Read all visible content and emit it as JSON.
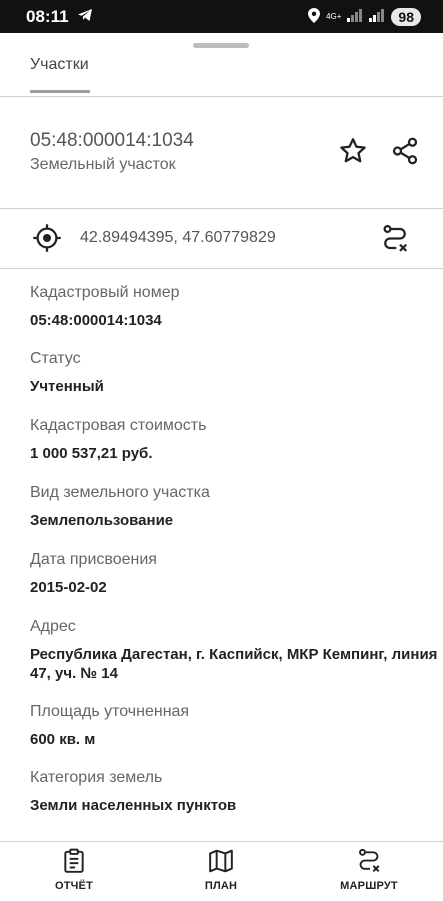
{
  "status_bar": {
    "time": "08:11",
    "network": "4G+",
    "battery": "98"
  },
  "tabs": [
    {
      "label": "Участки"
    }
  ],
  "header": {
    "cadastral_number": "05:48:000014:1034",
    "object_type": "Земельный участок"
  },
  "coordinates": "42.89494395, 47.60779829",
  "fields": [
    {
      "label": "Кадастровый номер",
      "value": "05:48:000014:1034"
    },
    {
      "label": "Статус",
      "value": "Учтенный"
    },
    {
      "label": "Кадастровая стоимость",
      "value": "1 000 537,21 руб."
    },
    {
      "label": "Вид земельного участка",
      "value": "Землепользование"
    },
    {
      "label": "Дата присвоения",
      "value": "2015-02-02"
    },
    {
      "label": "Адрес",
      "value": "Республика Дагестан, г. Каспийск, МКР Кемпинг, линия 47, уч. № 14"
    },
    {
      "label": "Площадь уточненная",
      "value": "600 кв. м"
    },
    {
      "label": "Категория земель",
      "value": "Земли населенных пунктов"
    }
  ],
  "bottom_nav": [
    {
      "label": "ОТЧЁТ",
      "icon": "report-icon"
    },
    {
      "label": "ПЛАН",
      "icon": "map-icon"
    },
    {
      "label": "МАРШРУТ",
      "icon": "route-icon"
    }
  ]
}
